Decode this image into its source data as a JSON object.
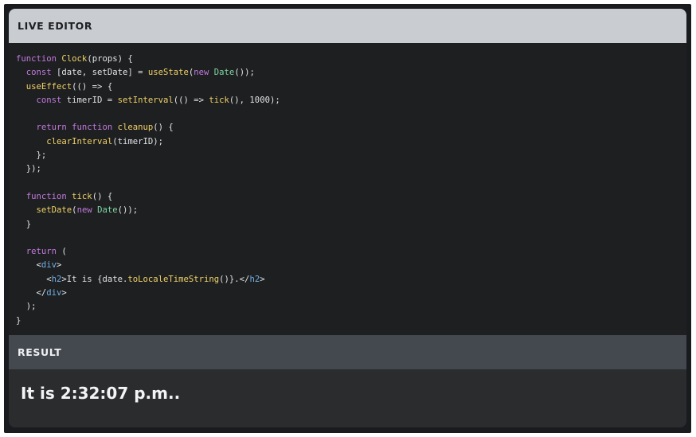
{
  "editor": {
    "title": "LIVE EDITOR",
    "code_lines": [
      [
        {
          "t": "function",
          "c": "kw"
        },
        {
          "t": " ",
          "c": "plain"
        },
        {
          "t": "Clock",
          "c": "fn"
        },
        {
          "t": "(props) {",
          "c": "plain"
        }
      ],
      [
        {
          "t": "  const",
          "c": "kw"
        },
        {
          "t": " [date, setDate] = ",
          "c": "plain"
        },
        {
          "t": "useState",
          "c": "fn"
        },
        {
          "t": "(",
          "c": "plain"
        },
        {
          "t": "new",
          "c": "kw"
        },
        {
          "t": " ",
          "c": "plain"
        },
        {
          "t": "Date",
          "c": "cls"
        },
        {
          "t": "());",
          "c": "plain"
        }
      ],
      [
        {
          "t": "  ",
          "c": "plain"
        },
        {
          "t": "useEffect",
          "c": "fn"
        },
        {
          "t": "(() => {",
          "c": "plain"
        }
      ],
      [
        {
          "t": "    const",
          "c": "kw"
        },
        {
          "t": " timerID = ",
          "c": "plain"
        },
        {
          "t": "setInterval",
          "c": "fn"
        },
        {
          "t": "(() => ",
          "c": "plain"
        },
        {
          "t": "tick",
          "c": "fn"
        },
        {
          "t": "(), 1000);",
          "c": "plain"
        }
      ],
      [],
      [
        {
          "t": "    return",
          "c": "kw"
        },
        {
          "t": " ",
          "c": "plain"
        },
        {
          "t": "function",
          "c": "kw"
        },
        {
          "t": " ",
          "c": "plain"
        },
        {
          "t": "cleanup",
          "c": "fn"
        },
        {
          "t": "() {",
          "c": "plain"
        }
      ],
      [
        {
          "t": "      ",
          "c": "plain"
        },
        {
          "t": "clearInterval",
          "c": "fn"
        },
        {
          "t": "(timerID);",
          "c": "plain"
        }
      ],
      [
        {
          "t": "    };",
          "c": "plain"
        }
      ],
      [
        {
          "t": "  });",
          "c": "plain"
        }
      ],
      [],
      [
        {
          "t": "  function",
          "c": "kw"
        },
        {
          "t": " ",
          "c": "plain"
        },
        {
          "t": "tick",
          "c": "fn"
        },
        {
          "t": "() {",
          "c": "plain"
        }
      ],
      [
        {
          "t": "    ",
          "c": "plain"
        },
        {
          "t": "setDate",
          "c": "fn"
        },
        {
          "t": "(",
          "c": "plain"
        },
        {
          "t": "new",
          "c": "kw"
        },
        {
          "t": " ",
          "c": "plain"
        },
        {
          "t": "Date",
          "c": "cls"
        },
        {
          "t": "());",
          "c": "plain"
        }
      ],
      [
        {
          "t": "  }",
          "c": "plain"
        }
      ],
      [],
      [
        {
          "t": "  return",
          "c": "kw"
        },
        {
          "t": " (",
          "c": "plain"
        }
      ],
      [
        {
          "t": "    <",
          "c": "plain"
        },
        {
          "t": "div",
          "c": "tag"
        },
        {
          "t": ">",
          "c": "plain"
        }
      ],
      [
        {
          "t": "      <",
          "c": "plain"
        },
        {
          "t": "h2",
          "c": "tag"
        },
        {
          "t": ">It is {date.",
          "c": "plain"
        },
        {
          "t": "toLocaleTimeString",
          "c": "fn"
        },
        {
          "t": "()}.</",
          "c": "plain"
        },
        {
          "t": "h2",
          "c": "tag"
        },
        {
          "t": ">",
          "c": "plain"
        }
      ],
      [
        {
          "t": "    </",
          "c": "plain"
        },
        {
          "t": "div",
          "c": "tag"
        },
        {
          "t": ">",
          "c": "plain"
        }
      ],
      [
        {
          "t": "  );",
          "c": "plain"
        }
      ],
      [
        {
          "t": "}",
          "c": "plain"
        }
      ]
    ]
  },
  "result": {
    "title": "RESULT",
    "output": "It is 2:32:07 p.m.."
  }
}
